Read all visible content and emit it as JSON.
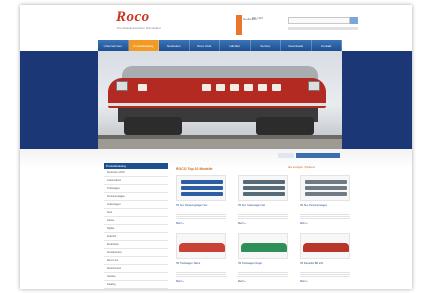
{
  "site": {
    "logo": "Roco",
    "tagline": "Die Modelleisenbahn Manufaktur",
    "promo_label": "Neuheiten",
    "lang": "DE / EN"
  },
  "nav": [
    "Unternehmen",
    "Produktkatalog",
    "Neuheiten",
    "Roco Club",
    "Händler",
    "Service",
    "Downloads",
    "Kontakt"
  ],
  "nav_active_index": 1,
  "colors": {
    "brand_red": "#c8351f",
    "nav_blue": "#1d4f8e",
    "band_blue": "#1b3775",
    "accent_orange": "#f19b24"
  },
  "sidebar": {
    "heading": "Produktkatalog",
    "items": [
      "Neuheiten 2010",
      "Lokomotiven",
      "Triebwagen",
      "Personenwagen",
      "Güterwagen",
      "Sets",
      "Gleise",
      "Digital",
      "Zubehör",
      "Ersatzteile",
      "Sonderserien",
      "Roco Line",
      "Fleischmann",
      "Geoline",
      "Katalog"
    ],
    "heading2": "Händlersuche"
  },
  "main": {
    "title": "ROCO Top 10 Modelle",
    "links": "Alle anzeigen | Sortieren"
  },
  "products": [
    {
      "title": "H0 Set: Reisezugwagen Set",
      "more": "Mehr »",
      "kind": "wagons",
      "color": "#2c5ea3"
    },
    {
      "title": "H0 Set: Güterwagen Set",
      "more": "Mehr »",
      "kind": "wagons",
      "color": "#556b77"
    },
    {
      "title": "H0 Set: Personenwagen",
      "more": "Mehr »",
      "kind": "wagons",
      "color": "#6f7a85"
    },
    {
      "title": "H0 Triebwagen Talent",
      "more": "Mehr »",
      "kind": "railcar",
      "color": "#c94236"
    },
    {
      "title": "H0 Triebwagen Regio",
      "more": "Mehr »",
      "kind": "railcar",
      "color": "#2f8f59"
    },
    {
      "title": "H0 Diesellok BR 232",
      "more": "Mehr »",
      "kind": "railcar",
      "color": "#b8352a"
    }
  ]
}
